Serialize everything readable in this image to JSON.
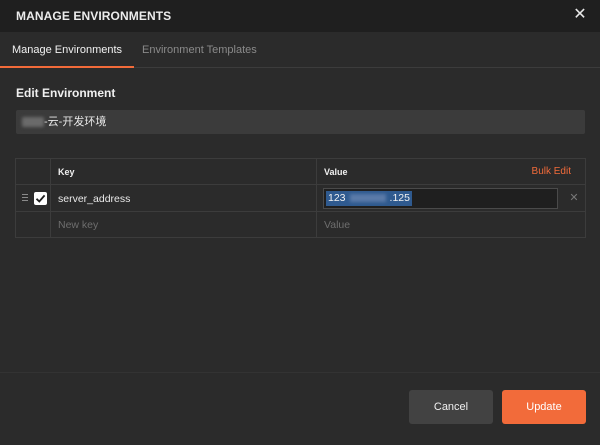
{
  "dialog": {
    "title": "MANAGE ENVIRONMENTS",
    "close_icon": "close-icon"
  },
  "tabs": [
    {
      "label": "Manage Environments",
      "active": true
    },
    {
      "label": "Environment Templates",
      "active": false
    }
  ],
  "edit": {
    "section_title": "Edit Environment",
    "environment_name": "-云-开发环境"
  },
  "table": {
    "headers": {
      "key": "Key",
      "value": "Value"
    },
    "bulk_edit_label": "Bulk Edit",
    "rows": [
      {
        "checked": true,
        "key": "server_address",
        "value_prefix": "123",
        "value_suffix": ".125"
      }
    ],
    "new_row": {
      "key_placeholder": "New key",
      "value_placeholder": "Value"
    }
  },
  "footer": {
    "cancel_label": "Cancel",
    "update_label": "Update"
  },
  "colors": {
    "accent": "#f26b3a",
    "background": "#2b2b2b",
    "titlebar": "#1f1f1f",
    "selection": "#2f5a8f"
  }
}
